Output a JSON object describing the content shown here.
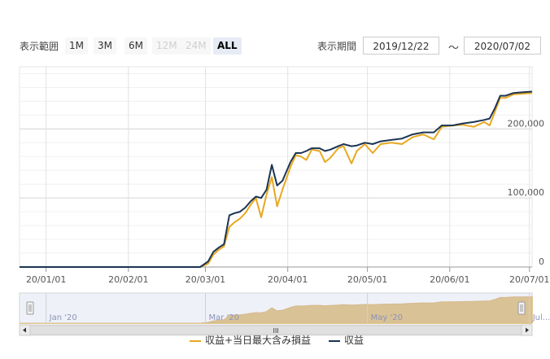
{
  "range_selector": {
    "label": "表示範囲",
    "buttons": [
      {
        "label": "1M",
        "state": "normal"
      },
      {
        "label": "3M",
        "state": "normal"
      },
      {
        "label": "6M",
        "state": "normal"
      },
      {
        "label": "12M",
        "state": "disabled"
      },
      {
        "label": "24M",
        "state": "disabled"
      },
      {
        "label": "ALL",
        "state": "active"
      }
    ]
  },
  "period": {
    "label": "表示期間",
    "from": "2019/12/22",
    "separator": "～",
    "to": "2020/07/02"
  },
  "navigator": {
    "labels": [
      "Jan '20",
      "Mar '20",
      "May '20",
      "Jul..."
    ],
    "scrollbar_grip": "III"
  },
  "colors": {
    "series_profit_incl_unrealized": "#e8a820",
    "series_profit": "#1c3553",
    "navigator_fill": "#d4a03c",
    "navigator_mask": "#dfe4f2"
  },
  "chart_data": {
    "type": "line",
    "x_tick_labels": [
      "20/01/01",
      "20/02/01",
      "20/03/01",
      "20/04/01",
      "20/05/01",
      "20/06/01",
      "20/07/01"
    ],
    "y_tick_labels": [
      "0",
      "100,000",
      "200,000"
    ],
    "ylim": [
      0,
      290000
    ],
    "x_range": [
      "2019-12-22",
      "2020-07-02"
    ],
    "grid": true,
    "legend_position": "bottom",
    "series": [
      {
        "name": "収益+当日最大含み損益",
        "color": "#e8a820",
        "points": [
          [
            "2019-12-22",
            0
          ],
          [
            "2020-02-28",
            0
          ],
          [
            "2020-03-02",
            5000
          ],
          [
            "2020-03-04",
            18000
          ],
          [
            "2020-03-06",
            25000
          ],
          [
            "2020-03-08",
            30000
          ],
          [
            "2020-03-10",
            58000
          ],
          [
            "2020-03-12",
            65000
          ],
          [
            "2020-03-14",
            70000
          ],
          [
            "2020-03-16",
            78000
          ],
          [
            "2020-03-18",
            90000
          ],
          [
            "2020-03-20",
            100000
          ],
          [
            "2020-03-22",
            72000
          ],
          [
            "2020-03-24",
            105000
          ],
          [
            "2020-03-26",
            130000
          ],
          [
            "2020-03-28",
            88000
          ],
          [
            "2020-03-30",
            112000
          ],
          [
            "2020-04-02",
            145000
          ],
          [
            "2020-04-04",
            162000
          ],
          [
            "2020-04-06",
            160000
          ],
          [
            "2020-04-08",
            155000
          ],
          [
            "2020-04-10",
            170000
          ],
          [
            "2020-04-13",
            168000
          ],
          [
            "2020-04-15",
            152000
          ],
          [
            "2020-04-17",
            158000
          ],
          [
            "2020-04-20",
            172000
          ],
          [
            "2020-04-22",
            175000
          ],
          [
            "2020-04-25",
            150000
          ],
          [
            "2020-04-27",
            168000
          ],
          [
            "2020-04-30",
            178000
          ],
          [
            "2020-05-03",
            165000
          ],
          [
            "2020-05-06",
            178000
          ],
          [
            "2020-05-10",
            180000
          ],
          [
            "2020-05-14",
            178000
          ],
          [
            "2020-05-18",
            188000
          ],
          [
            "2020-05-22",
            192000
          ],
          [
            "2020-05-26",
            185000
          ],
          [
            "2020-05-29",
            203000
          ],
          [
            "2020-06-02",
            205000
          ],
          [
            "2020-06-06",
            206000
          ],
          [
            "2020-06-10",
            203000
          ],
          [
            "2020-06-14",
            210000
          ],
          [
            "2020-06-16",
            205000
          ],
          [
            "2020-06-18",
            225000
          ],
          [
            "2020-06-20",
            245000
          ],
          [
            "2020-06-22",
            245000
          ],
          [
            "2020-06-25",
            250000
          ],
          [
            "2020-07-02",
            252000
          ]
        ]
      },
      {
        "name": "収益",
        "color": "#1c3553",
        "points": [
          [
            "2019-12-22",
            0
          ],
          [
            "2020-02-28",
            0
          ],
          [
            "2020-03-02",
            8000
          ],
          [
            "2020-03-04",
            22000
          ],
          [
            "2020-03-06",
            28000
          ],
          [
            "2020-03-08",
            33000
          ],
          [
            "2020-03-10",
            75000
          ],
          [
            "2020-03-12",
            78000
          ],
          [
            "2020-03-14",
            80000
          ],
          [
            "2020-03-16",
            86000
          ],
          [
            "2020-03-18",
            95000
          ],
          [
            "2020-03-20",
            102000
          ],
          [
            "2020-03-22",
            100000
          ],
          [
            "2020-03-24",
            112000
          ],
          [
            "2020-03-26",
            148000
          ],
          [
            "2020-03-28",
            118000
          ],
          [
            "2020-03-30",
            125000
          ],
          [
            "2020-04-02",
            152000
          ],
          [
            "2020-04-04",
            165000
          ],
          [
            "2020-04-06",
            165000
          ],
          [
            "2020-04-08",
            168000
          ],
          [
            "2020-04-10",
            172000
          ],
          [
            "2020-04-13",
            172000
          ],
          [
            "2020-04-15",
            168000
          ],
          [
            "2020-04-17",
            170000
          ],
          [
            "2020-04-20",
            175000
          ],
          [
            "2020-04-22",
            178000
          ],
          [
            "2020-04-25",
            175000
          ],
          [
            "2020-04-27",
            176000
          ],
          [
            "2020-04-30",
            180000
          ],
          [
            "2020-05-03",
            178000
          ],
          [
            "2020-05-06",
            182000
          ],
          [
            "2020-05-10",
            184000
          ],
          [
            "2020-05-14",
            186000
          ],
          [
            "2020-05-18",
            192000
          ],
          [
            "2020-05-22",
            195000
          ],
          [
            "2020-05-26",
            195000
          ],
          [
            "2020-05-29",
            205000
          ],
          [
            "2020-06-02",
            205000
          ],
          [
            "2020-06-06",
            208000
          ],
          [
            "2020-06-10",
            210000
          ],
          [
            "2020-06-14",
            213000
          ],
          [
            "2020-06-16",
            215000
          ],
          [
            "2020-06-18",
            230000
          ],
          [
            "2020-06-20",
            248000
          ],
          [
            "2020-06-22",
            248000
          ],
          [
            "2020-06-25",
            252000
          ],
          [
            "2020-07-02",
            254000
          ]
        ]
      }
    ]
  }
}
